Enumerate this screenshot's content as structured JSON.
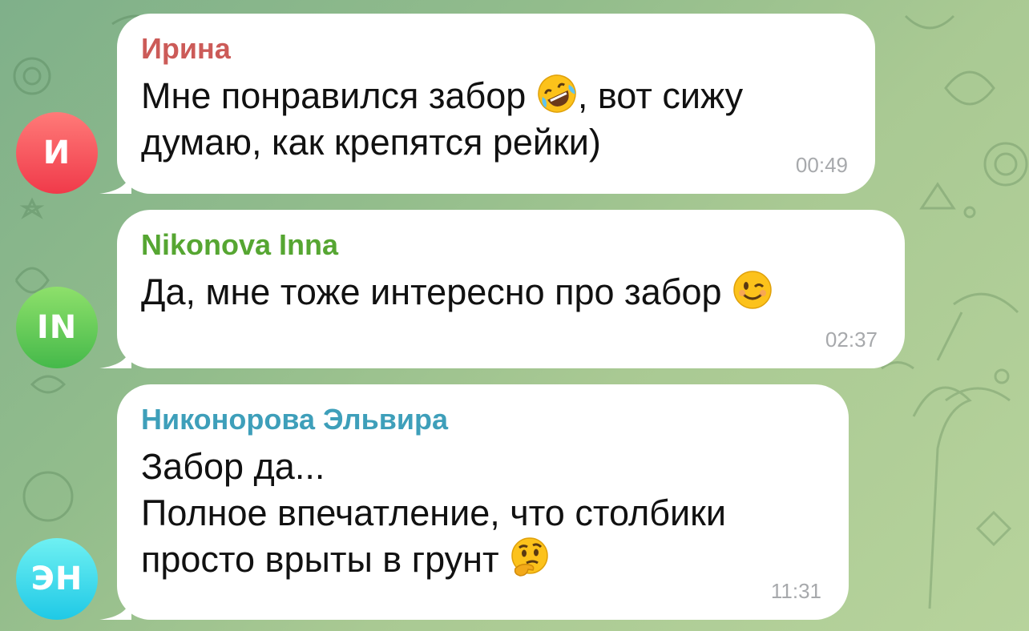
{
  "colors": {
    "bubble": "#ffffff",
    "text": "#111111",
    "time": "#a7a9ac"
  },
  "messages": [
    {
      "sender": "Ирина",
      "sender_color": "#cc5b58",
      "avatar_initials": "И",
      "avatar_gradient": [
        "#ff7a78",
        "#f03a4a"
      ],
      "lines": [
        {
          "before": "Мне понравился забор ",
          "emoji": "rolling-on-floor-laughing-emoji",
          "after": ", вот сижу"
        },
        {
          "before": "думаю, как крепятся рейки)",
          "emoji": "",
          "after": ""
        }
      ],
      "time": "00:49"
    },
    {
      "sender": "Nikonova Inna",
      "sender_color": "#56a632",
      "avatar_initials": "IN",
      "avatar_gradient": [
        "#8ee06b",
        "#45b94a"
      ],
      "lines": [
        {
          "before": "Да, мне тоже интересно про забор ",
          "emoji": "winking-face-emoji",
          "after": ""
        }
      ],
      "time": "02:37"
    },
    {
      "sender": "Никонорова Эльвира",
      "sender_color": "#3e9fba",
      "avatar_initials": "ЭН",
      "avatar_gradient": [
        "#6ff0f2",
        "#1fc9e6"
      ],
      "lines": [
        {
          "before": "Забор да...",
          "emoji": "",
          "after": ""
        },
        {
          "before": "Полное впечатление, что столбики",
          "emoji": "",
          "after": ""
        },
        {
          "before": "просто врыты в грунт ",
          "emoji": "thinking-face-emoji",
          "after": ""
        }
      ],
      "time": "11:31"
    }
  ]
}
